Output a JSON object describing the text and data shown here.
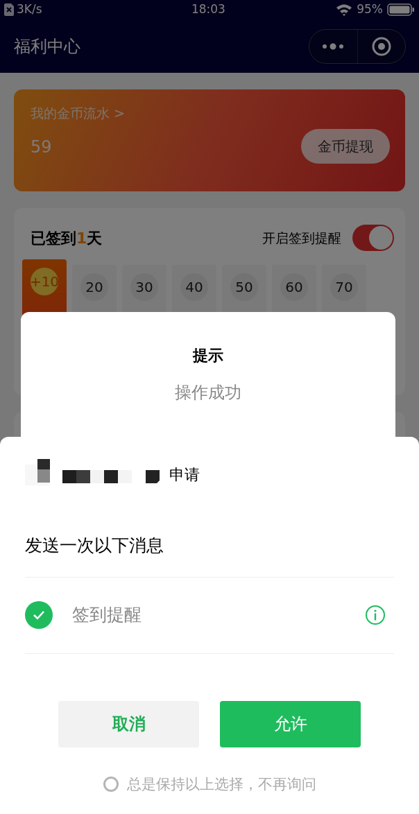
{
  "status_bar": {
    "speed": "3K/s",
    "time": "18:03",
    "battery": "95%"
  },
  "nav": {
    "title": "福利中心"
  },
  "coins": {
    "link": "我的金币流水 >",
    "amount": "59",
    "button": "金币提现"
  },
  "signin": {
    "title_before": "已签到",
    "days": "1",
    "title_after": "天",
    "reminder_label": "开启签到提醒",
    "reminder_on": true,
    "tiles": [
      {
        "reward": "+10",
        "selected": true
      },
      {
        "reward": "20",
        "selected": false
      },
      {
        "reward": "30",
        "selected": false
      },
      {
        "reward": "40",
        "selected": false
      },
      {
        "reward": "50",
        "selected": false
      },
      {
        "reward": "60",
        "selected": false
      },
      {
        "reward": "70",
        "selected": false
      }
    ]
  },
  "dialog": {
    "title": "提示",
    "message": "操作成功"
  },
  "sheet": {
    "request": "申请",
    "heading": "发送一次以下消息",
    "items": [
      {
        "label": "签到提醒",
        "checked": true
      }
    ],
    "cancel": "取消",
    "allow": "允许",
    "remember": {
      "label": "总是保持以上选择，不再询问",
      "checked": false
    }
  }
}
